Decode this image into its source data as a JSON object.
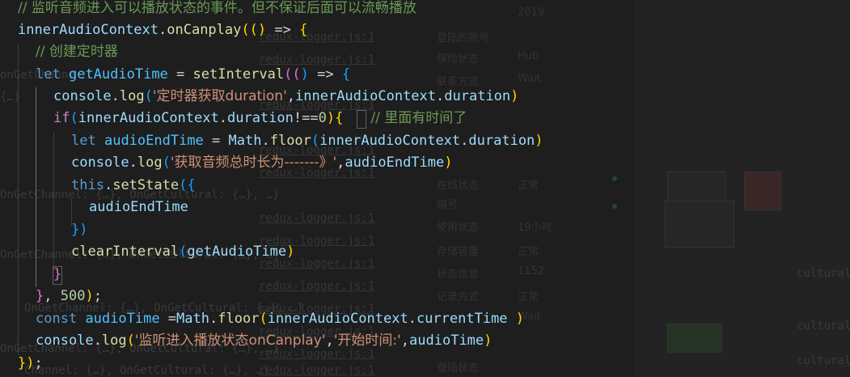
{
  "code_lines": [
    {
      "comment": "// 监听音频进入可以播放状态的事件。但不保证后面可以流畅播放"
    },
    {
      "t": [
        "innerAudioContext",
        ".",
        "onCanplay",
        "(",
        "(",
        ")",
        " => ",
        "{"
      ]
    },
    {
      "comment": "// 创建定时器"
    },
    {
      "t": [
        "let",
        " ",
        "getAudioTime",
        " = ",
        "setInterval",
        "(",
        "(",
        ")",
        " => ",
        "{"
      ]
    },
    {
      "t": [
        "console",
        ".",
        "log",
        "(",
        "'定时器获取duration'",
        ",",
        "innerAudioContext",
        ".",
        "duration",
        ")"
      ]
    },
    {
      "t": [
        "if",
        "(",
        "innerAudioContext",
        ".",
        "duration",
        "!==",
        "0",
        ")",
        "{"
      ],
      "comment": "// 里面有时间了"
    },
    {
      "t": [
        "let",
        " ",
        "audioEndTime",
        " = ",
        "Math",
        ".",
        "floor",
        "(",
        "innerAudioContext",
        ".",
        "duration",
        ")"
      ]
    },
    {
      "t": [
        "console",
        ".",
        "log",
        "(",
        "'获取音频总时长为-------》'",
        ",",
        "audioEndTime",
        ")"
      ]
    },
    {
      "t": [
        "this",
        ".",
        "setState",
        "(",
        "{"
      ]
    },
    {
      "t": [
        "audioEndTime"
      ]
    },
    {
      "t": [
        "}",
        ")"
      ]
    },
    {
      "t": [
        "clearInterval",
        "(",
        "getAudioTime",
        ")"
      ]
    },
    {
      "t": [
        "}"
      ]
    },
    {
      "t": [
        "}",
        ", ",
        "500",
        ")",
        ";"
      ]
    },
    {
      "t": [
        "const",
        " ",
        "audioTime",
        " =",
        "Math",
        ".",
        "floor",
        "(",
        "innerAudioContext",
        ".",
        "currentTime",
        " ",
        ")"
      ]
    },
    {
      "t": [
        "console",
        ".",
        "log",
        "(",
        "'监听进入播放状态onCanplay'",
        ",",
        "'开始时间:'",
        ",",
        "audioTime",
        ")"
      ]
    },
    {
      "t": [
        "}",
        ")",
        ";"
      ]
    }
  ],
  "ghost": {
    "links": [
      "redux-logger.js:1",
      "redux-logger.js:1",
      "redux-logger.js:1",
      "redux-logger.js:1",
      "redux-logger.js:1",
      "redux-logger.js:1",
      "redux-logger.js:1",
      "redux-logger.js:1",
      "redux-logger.js:1",
      "redux-logger.js:1",
      "redux-logger.js:1",
      "redux-logger.js:1",
      "redux-logger.js:1"
    ],
    "objects": [
      "onGetChanne",
      "{…}",
      "OnGetChannel: {…}, OnGetCultural: {…}, …}",
      "OnGetChannel: {…}, OnGetCultural: {…}, …}",
      "OnGetChannel: {…}, OnGetCultural: {…}, …}",
      "OnGetChannel: {…}, OnGetCultural: {…}, …}",
      "Channel: {…}, OnGetCultural: {…}, …}"
    ],
    "right_labels": [
      "登陆的账号",
      "保险状态",
      "联系方式",
      "在线状态",
      "编号",
      "使用状态",
      "存储容量",
      "状态信息",
      "记录方式",
      "登陆状态"
    ],
    "right_values": [
      "2019",
      "Hub",
      "Wait",
      "正常",
      "19小时",
      "正常",
      "1152",
      "正常",
      "Wait"
    ],
    "right_right": [
      "cultural:",
      "cultural:",
      "cultural:"
    ]
  },
  "colors": {
    "background": "#1e1e1e",
    "comment": "#6a9955",
    "keyword": "#569cd6",
    "control": "#c586c0",
    "variable": "#9cdcfe",
    "const_var": "#4fc1ff",
    "function": "#dcdcaa",
    "string": "#ce9178",
    "number": "#b5cea8"
  }
}
